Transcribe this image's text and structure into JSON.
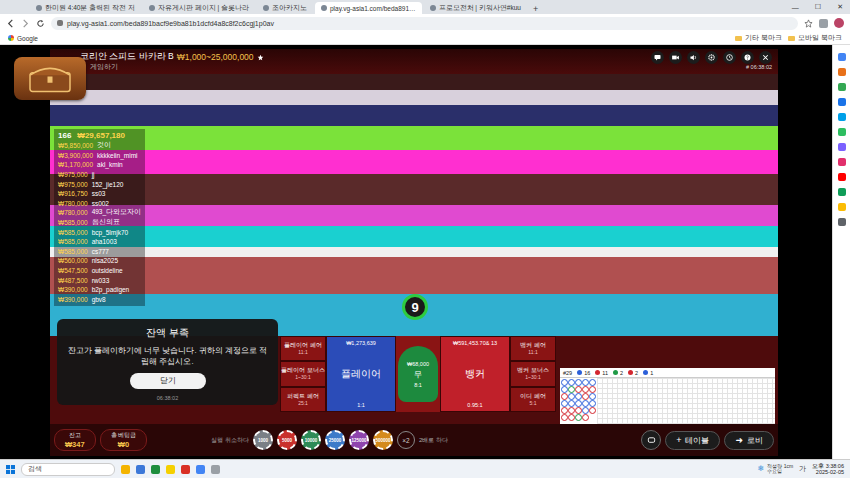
{
  "browser": {
    "tabs": [
      {
        "label": "한미원 4:40분 출력된 작전 저",
        "selected": false
      },
      {
        "label": "자유게시판 페이지 | 슬롯나라",
        "selected": false
      },
      {
        "label": "조아카지노",
        "selected": false
      },
      {
        "label": "play.vg-asia1.com/beda891…",
        "selected": true
      },
      {
        "label": "프로모전처 | 키워사연#kuu",
        "selected": false
      }
    ],
    "new_tab": "+",
    "window_controls": [
      "—",
      "☐",
      "✕"
    ],
    "address": "play.vg-asia1.com/beda891bacf9e9ba81b1dcfd4a8c8f2c6cgj1p0av",
    "bookmarks": [
      "Google"
    ],
    "bookmark_folders": [
      "기타 북마크",
      "모바일 북마크"
    ]
  },
  "side_panel": [
    {
      "color": "#4285f4"
    },
    {
      "color": "#e8711a"
    },
    {
      "color": "#34a853"
    },
    {
      "color": "#1a73e8"
    },
    {
      "color": "#00a0e9"
    },
    {
      "color": "#2dbe60"
    },
    {
      "color": "#7b61ff"
    },
    {
      "color": "#e1306c"
    },
    {
      "color": "#ff0000"
    },
    {
      "color": "#0f9d58"
    },
    {
      "color": "#fbbc04"
    },
    {
      "color": "#5f6368"
    }
  ],
  "game": {
    "title": "코리안 스피드 바카라 B",
    "limits": "₩1,000~25,000,000",
    "search_label": "게임하기",
    "round_time": "# 06:38:02",
    "players": "166",
    "total_wager": "₩29,657,180",
    "leaderboard": [
      {
        "amount": "₩5,850,000",
        "name": "것이"
      },
      {
        "amount": "₩3,900,000",
        "name": "kkkkeiin_mimi"
      },
      {
        "amount": "₩1,170,000",
        "name": "akl_kmin"
      },
      {
        "amount": "₩975,000",
        "name": "jj"
      },
      {
        "amount": "₩975,000",
        "name": "152_jie120"
      },
      {
        "amount": "₩916,750",
        "name": "ss03"
      },
      {
        "amount": "₩780,000",
        "name": "ss002"
      },
      {
        "amount": "₩780,000",
        "name": "493_다와모자이"
      },
      {
        "amount": "₩585,000",
        "name": "음신의표"
      },
      {
        "amount": "₩585,000",
        "name": "bcp_5lmjk70"
      },
      {
        "amount": "₩585,000",
        "name": "aha1003"
      },
      {
        "amount": "₩585,000",
        "name": "cs777"
      },
      {
        "amount": "₩560,000",
        "name": "nlsa2025"
      },
      {
        "amount": "₩547,500",
        "name": "outsideline"
      },
      {
        "amount": "₩487,500",
        "name": "rw033"
      },
      {
        "amount": "₩390,000",
        "name": "b2p_padigen"
      },
      {
        "amount": "₩390,000",
        "name": "gbv8"
      }
    ],
    "timer": "9",
    "bets": {
      "left": [
        {
          "label": "플레이어 페어",
          "payout": "11:1"
        },
        {
          "label": "플레이어 보너스",
          "payout": "1~30:1"
        },
        {
          "label": "퍼펙트 페어",
          "payout": "25:1"
        }
      ],
      "main": [
        {
          "kind": "side",
          "label": "플레이어",
          "payout": "1:1",
          "pool": "₩1,273,639",
          "count": "",
          "color": "#2b4cb8"
        },
        {
          "kind": "tie",
          "label": "무",
          "payout": "8:1",
          "pool": "₩68,000",
          "count": "",
          "color": "#1d8a3e"
        },
        {
          "kind": "side",
          "label": "뱅커",
          "payout": "0.95:1",
          "pool": "₩591,453.70",
          "count": "13",
          "color": "#c0202a"
        }
      ],
      "right": [
        {
          "label": "뱅커 페어",
          "payout": "11:1"
        },
        {
          "label": "뱅커 보너스",
          "payout": "1~30:1"
        },
        {
          "label": "이디 페어",
          "payout": "5:1"
        }
      ]
    },
    "dialog": {
      "title": "잔액 부족",
      "message": "잔고가 플레이하기에 너무 낮습니다. 귀하의 계정으로 적립해 주십시오.",
      "button": "닫기",
      "time": "06:38:02"
    },
    "balance": {
      "label": "잔고",
      "value": "₩347"
    },
    "total_bet": {
      "label": "총 베팅금",
      "value": "₩0"
    },
    "undo": "실행 취소하다",
    "double_icon": "×2",
    "double": "2배로 하다",
    "chips": [
      {
        "label": "1000",
        "color": "#7a7f86"
      },
      {
        "label": "5000",
        "color": "#c9302c"
      },
      {
        "label": "10000",
        "color": "#2e8b57"
      },
      {
        "label": "25000",
        "color": "#3d7bc9"
      },
      {
        "label": "125000",
        "color": "#8e44ad"
      },
      {
        "label": "500000",
        "color": "#d48a1c"
      }
    ],
    "table_icon": "+",
    "table_button": "테이블",
    "lobby_icon": "➜",
    "lobby_button": "로비",
    "road": {
      "round": "#29",
      "stats": [
        {
          "value": "16",
          "color": "#2b5fd9"
        },
        {
          "value": "11",
          "color": "#d3262f"
        },
        {
          "value": "2",
          "color": "#1f9a46"
        },
        {
          "value": "2",
          "color": "#d3262f"
        },
        {
          "value": "1",
          "color": "#2b5fd9"
        }
      ],
      "beads": [
        "P",
        "P",
        "B",
        "P",
        "B",
        "B",
        "P",
        "T",
        "P",
        "P",
        "B",
        "B",
        "P",
        "B",
        "P",
        "P",
        "B",
        "T",
        "P",
        "B",
        "B",
        "P",
        "P",
        "B",
        "P",
        "B",
        "P",
        "P",
        "B"
      ]
    }
  },
  "taskbar": {
    "search": "검색",
    "weather": "적설량 1cm",
    "weather_sub": "수요일",
    "ime": "가",
    "time": "오후 3:38:06",
    "date": "2025-02-05",
    "apps": [
      {
        "color": "#f4b400"
      },
      {
        "color": "#3c78d8"
      },
      {
        "color": "#1e8e3e"
      },
      {
        "color": "#f5d000"
      },
      {
        "color": "#d93025"
      },
      {
        "color": "#4285f4"
      },
      {
        "color": "#9aa0a6"
      }
    ]
  }
}
